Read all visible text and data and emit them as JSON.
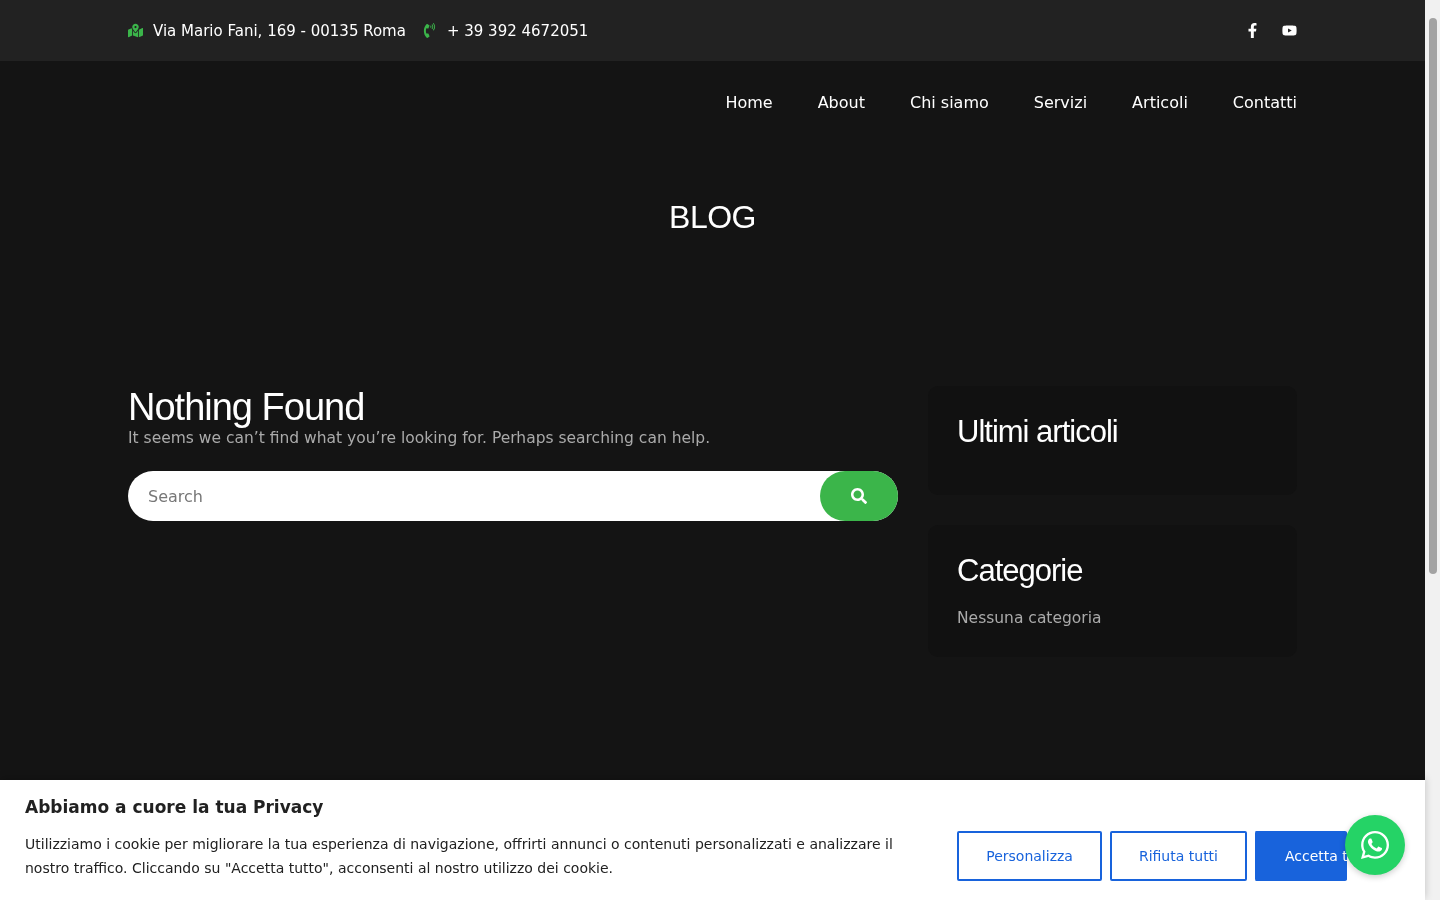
{
  "topbar": {
    "address": "Via Mario Fani, 169 - 00135 Roma",
    "phone": "+ 39 392 4672051"
  },
  "nav": [
    {
      "label": "Home"
    },
    {
      "label": "About"
    },
    {
      "label": "Chi siamo"
    },
    {
      "label": "Servizi"
    },
    {
      "label": "Articoli"
    },
    {
      "label": "Contatti"
    }
  ],
  "page_title": "BLOG",
  "main": {
    "heading": "Nothing Found",
    "text": "It seems we can’t find what you’re looking for. Perhaps searching can help.",
    "search": {
      "placeholder": "Search"
    }
  },
  "sidebar": [
    {
      "title": "Ultimi articoli"
    },
    {
      "title": "Categorie",
      "text": "Nessuna categoria"
    }
  ],
  "cookie_banner": {
    "title": "Abbiamo a cuore la tua Privacy",
    "text": "Utilizziamo i cookie per migliorare la tua esperienza di navigazione, offrirti annunci o contenuti personalizzati e analizzare il nostro traffico. Cliccando su \"Accetta tutto\", acconsenti al nostro utilizzo dei cookie.",
    "buttons": [
      {
        "label": "Personalizza",
        "kind": "outline"
      },
      {
        "label": "Rifiuta tutti",
        "kind": "outline"
      },
      {
        "label": "Accetta t",
        "kind": "primary"
      }
    ]
  }
}
